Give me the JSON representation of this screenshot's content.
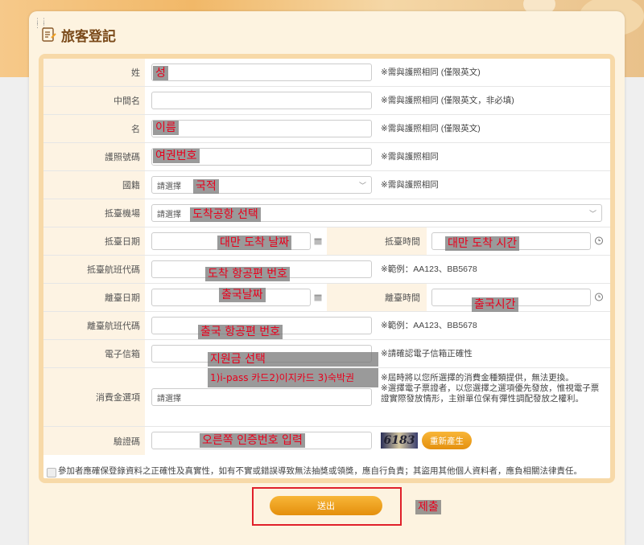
{
  "page": {
    "title": "旅客登記"
  },
  "fields": {
    "last_name": {
      "label": "姓",
      "note": "※需與護照相同 (僅限英文)",
      "annotation": "성"
    },
    "middle_name": {
      "label": "中間名",
      "note": "※需與護照相同 (僅限英文，非必填)"
    },
    "first_name": {
      "label": "名",
      "note": "※需與護照相同 (僅限英文)",
      "annotation": "이름"
    },
    "passport": {
      "label": "護照號碼",
      "note": "※需與護照相同",
      "annotation": "여권번호"
    },
    "nationality": {
      "label": "國籍",
      "placeholder": "請選擇",
      "note": "※需與護照相同",
      "annotation": "국적"
    },
    "arrival_airport": {
      "label": "抵臺機場",
      "placeholder": "請選擇",
      "annotation": "도착공항 선택"
    },
    "arrival_date": {
      "label": "抵臺日期",
      "annotation": "대만 도착 날짜"
    },
    "arrival_time": {
      "label": "抵臺時間",
      "annotation": "대만 도착 시간"
    },
    "arrival_flight": {
      "label": "抵臺航班代碼",
      "note": "※範例：AA123、BB5678",
      "annotation": "도착 항공편 번호"
    },
    "departure_date": {
      "label": "離臺日期",
      "annotation": "출국날짜"
    },
    "departure_time": {
      "label": "離臺時間",
      "annotation": "출국시간"
    },
    "departure_flight": {
      "label": "離臺航班代碼",
      "note": "※範例：AA123、BB5678",
      "annotation": "출국 항공편 번호"
    },
    "email": {
      "label": "電子信箱",
      "note": "※請確認電子信箱正確性",
      "annotation": "지원금 선택"
    },
    "voucher": {
      "label": "消費金選項",
      "placeholder": "請選擇",
      "note1": "※屆時將以您所選擇的消費金種類提供，無法更換。",
      "note2": "※選擇電子票證者，以您選擇之選項優先發放，惟視電子票證實際發放情形，主辦單位保有彈性調配發放之權利。",
      "annotation": "1)i-pass 카드2)이지카드 3)숙박권"
    },
    "captcha": {
      "label": "驗證碼",
      "image_text": "6183",
      "regen_label": "重新產生",
      "annotation": "오른쪽 인증번호 입력"
    }
  },
  "agreement": {
    "text": "參加者應確保登錄資料之正確性及真實性，如有不實或錯誤導致無法抽獎或領獎，應自行負責；其盜用其他個人資料者，應負相關法律責任。"
  },
  "submit": {
    "label": "送出",
    "annotation": "제출"
  },
  "colors": {
    "accent": "#f0a020",
    "label_bg": "#fdf3e3",
    "annotation_text": "#e8001c",
    "highlight_frame": "#e0202a"
  }
}
